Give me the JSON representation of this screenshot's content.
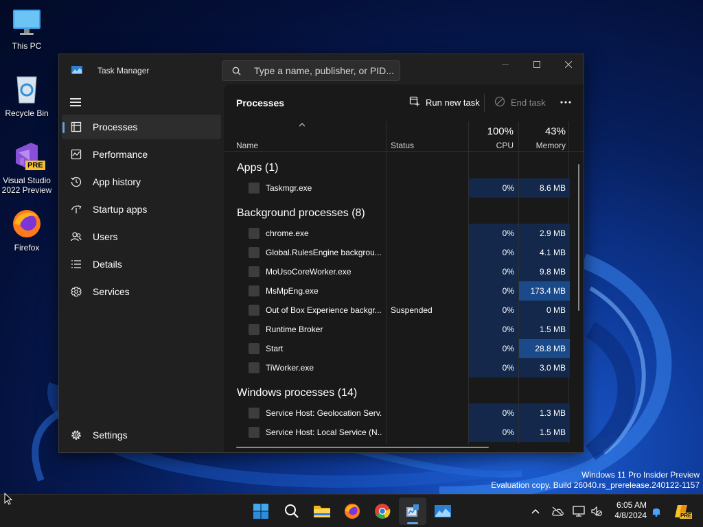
{
  "desktop": {
    "icons": [
      {
        "label": "This PC",
        "icon": "monitor-icon"
      },
      {
        "label": "Recycle Bin",
        "icon": "recycle-bin-icon"
      },
      {
        "label": "Visual Studio 2022 Preview",
        "icon": "visual-studio-icon",
        "badge": "PRE"
      },
      {
        "label": "Firefox",
        "icon": "firefox-icon"
      }
    ],
    "watermark": {
      "line1": "Windows 11 Pro Insider Preview",
      "line2": "Evaluation copy. Build 26040.rs_prerelease.240122-1157"
    }
  },
  "window": {
    "title": "Task Manager",
    "search_placeholder": "Type a name, publisher, or PID...",
    "controls": [
      "minimize-icon",
      "maximize-icon",
      "close-icon"
    ]
  },
  "sidebar": {
    "items": [
      {
        "label": "Processes",
        "icon": "processes-icon",
        "active": true
      },
      {
        "label": "Performance",
        "icon": "performance-icon"
      },
      {
        "label": "App history",
        "icon": "history-icon"
      },
      {
        "label": "Startup apps",
        "icon": "startup-icon"
      },
      {
        "label": "Users",
        "icon": "users-icon"
      },
      {
        "label": "Details",
        "icon": "details-icon"
      },
      {
        "label": "Services",
        "icon": "services-icon"
      }
    ],
    "settings_label": "Settings"
  },
  "toolbar": {
    "page_title": "Processes",
    "run_new_task": "Run new task",
    "end_task": "End task"
  },
  "columns": {
    "name": "Name",
    "status": "Status",
    "cpu_total": "100%",
    "cpu": "CPU",
    "memory_total": "43%",
    "memory": "Memory"
  },
  "groups": [
    {
      "title": "Apps (1)",
      "rows": [
        {
          "name": "Taskmgr.exe",
          "status": "",
          "cpu": "0%",
          "memory": "8.6 MB"
        }
      ]
    },
    {
      "title": "Background processes (8)",
      "rows": [
        {
          "name": "chrome.exe",
          "status": "",
          "cpu": "0%",
          "memory": "2.9 MB"
        },
        {
          "name": "Global.RulesEngine backgrou...",
          "status": "",
          "cpu": "0%",
          "memory": "4.1 MB"
        },
        {
          "name": "MoUsoCoreWorker.exe",
          "status": "",
          "cpu": "0%",
          "memory": "9.8 MB"
        },
        {
          "name": "MsMpEng.exe",
          "status": "",
          "cpu": "0%",
          "memory": "173.4 MB",
          "highlight": true
        },
        {
          "name": "Out of Box Experience backgr...",
          "status": "Suspended",
          "cpu": "0%",
          "memory": "0 MB"
        },
        {
          "name": "Runtime Broker",
          "status": "",
          "cpu": "0%",
          "memory": "1.5 MB"
        },
        {
          "name": "Start",
          "status": "",
          "cpu": "0%",
          "memory": "28.8 MB",
          "highlight": true
        },
        {
          "name": "TiWorker.exe",
          "status": "",
          "cpu": "0%",
          "memory": "3.0 MB"
        }
      ]
    },
    {
      "title": "Windows processes (14)",
      "rows": [
        {
          "name": "Service Host: Geolocation Serv...",
          "status": "",
          "cpu": "0%",
          "memory": "1.3 MB"
        },
        {
          "name": "Service Host: Local Service (N...",
          "status": "",
          "cpu": "0%",
          "memory": "1.5 MB"
        }
      ]
    }
  ],
  "taskbar": {
    "apps": [
      "start-icon",
      "search-icon",
      "file-explorer-icon",
      "firefox-icon",
      "chrome-icon",
      "task-manager-icon",
      "remote-desktop-icon"
    ],
    "time": "6:05 AM",
    "date": "4/8/2024",
    "pre_badge": "PRE"
  },
  "colors": {
    "accent": "#5aa0e6",
    "window_bg": "#202020",
    "content_bg": "#191919",
    "heat_low": "#13284a",
    "heat_high": "#1a4a8a"
  }
}
